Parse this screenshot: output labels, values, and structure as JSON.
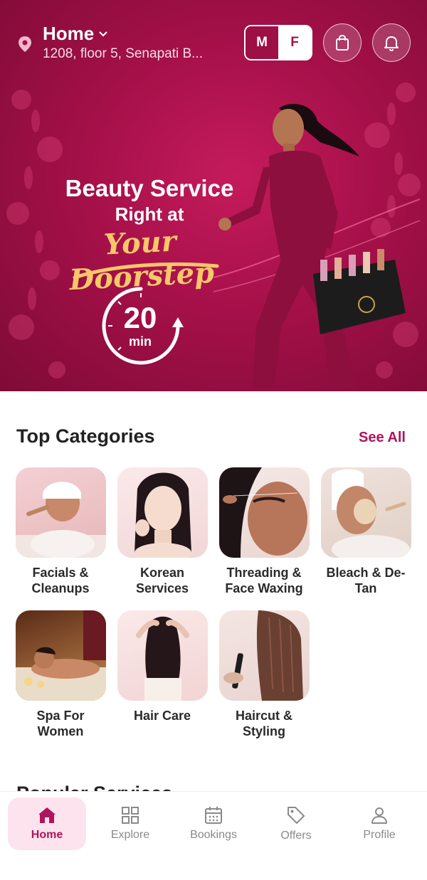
{
  "colors": {
    "brand": "#a51049",
    "accent_gold": "#f7c76a",
    "see_all": "#b0145a",
    "nav_active_bg": "#fde3ee"
  },
  "header": {
    "location_title": "Home",
    "location_address": "1208, floor 5, Senapati B...",
    "gender_options": [
      "M",
      "F"
    ],
    "gender_selected": "F",
    "cart_icon": "shopping-bag-icon",
    "notification_icon": "bell-icon"
  },
  "hero": {
    "line1": "Beauty Service",
    "line2": "Right at",
    "script": "Your Doorstep",
    "timer_value": "20",
    "timer_unit": "min"
  },
  "categories": {
    "title": "Top Categories",
    "see_all": "See All",
    "items": [
      {
        "label": "Facials & Cleanups"
      },
      {
        "label": "Korean Services"
      },
      {
        "label": "Threading & Face Waxing"
      },
      {
        "label": "Bleach & De-Tan"
      },
      {
        "label": "Spa For Women"
      },
      {
        "label": "Hair Care"
      },
      {
        "label": "Haircut & Styling"
      }
    ]
  },
  "next_section_peek": "Popular Services",
  "bottom_nav": {
    "active": "Home",
    "items": [
      {
        "label": "Home",
        "icon": "home-icon"
      },
      {
        "label": "Explore",
        "icon": "grid-icon"
      },
      {
        "label": "Bookings",
        "icon": "calendar-icon"
      },
      {
        "label": "Offers",
        "icon": "tag-icon"
      },
      {
        "label": "Profile",
        "icon": "user-icon"
      }
    ]
  }
}
